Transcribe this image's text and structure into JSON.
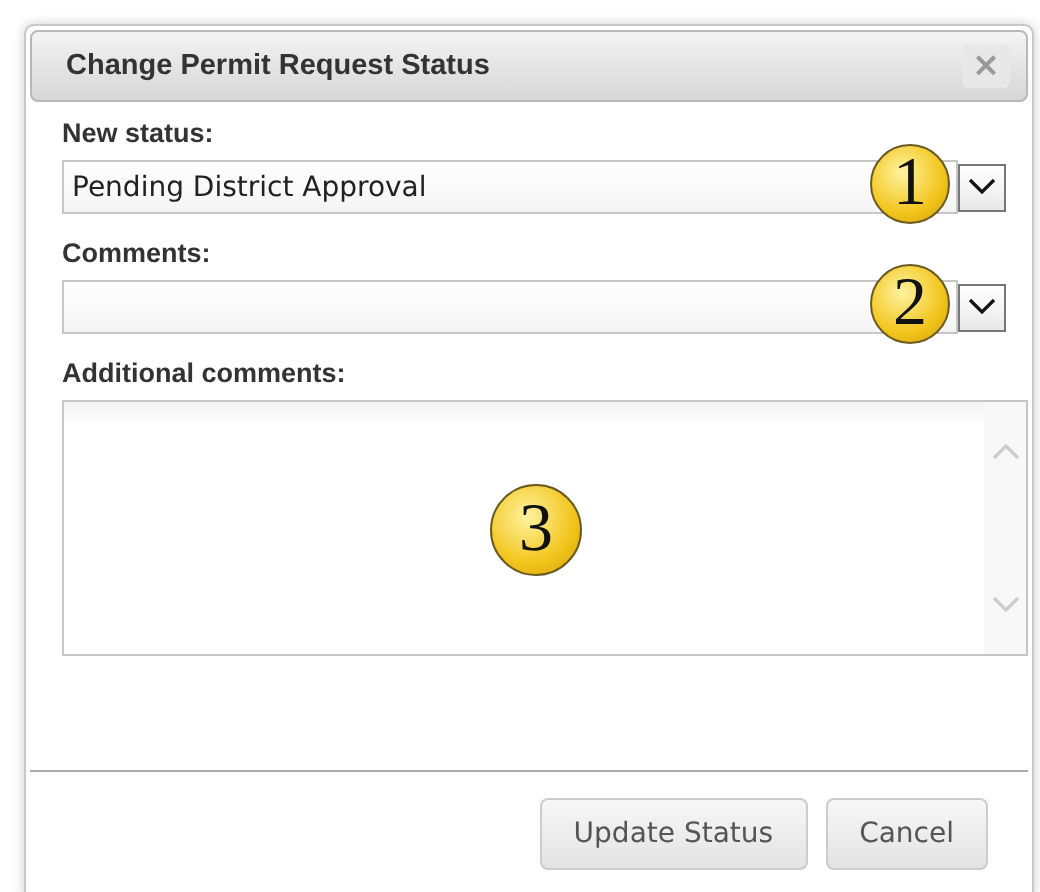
{
  "dialog": {
    "title": "Change Permit Request Status",
    "close": "×"
  },
  "fields": [
    {
      "kind": "select",
      "label": "New status:",
      "value": "Pending District Approval",
      "callout": "1"
    },
    {
      "kind": "select",
      "label": "Comments:",
      "callout": "2"
    },
    {
      "kind": "textarea",
      "label": "Additional comments:",
      "callout": "3"
    }
  ],
  "buttons": [
    "Update Status",
    "Cancel"
  ]
}
